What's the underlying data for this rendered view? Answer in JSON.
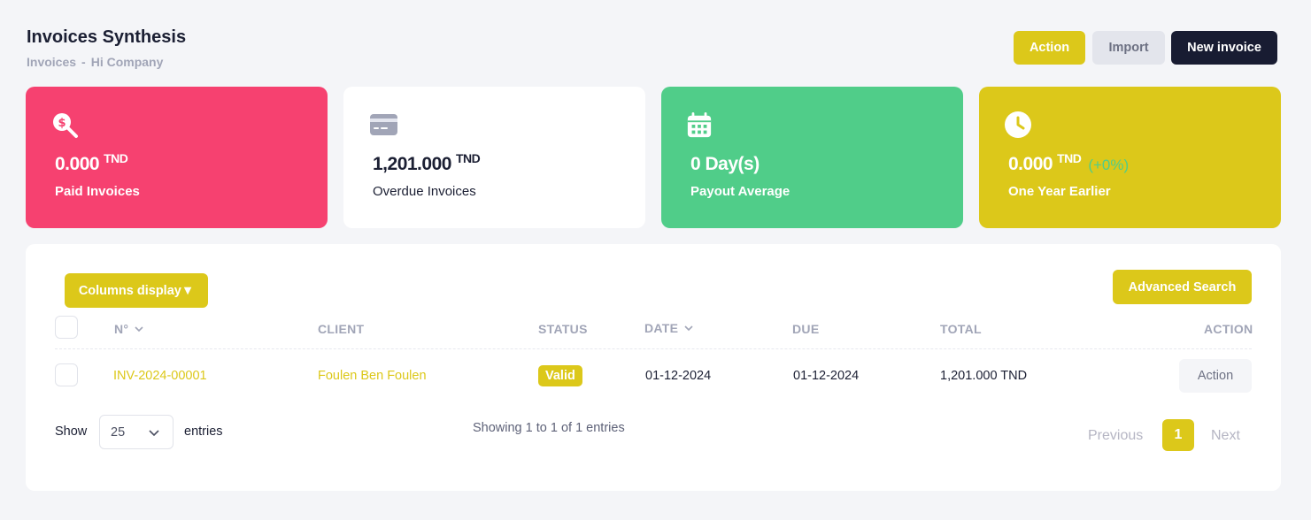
{
  "header": {
    "title": "Invoices Synthesis",
    "breadcrumb": [
      "Invoices",
      "-",
      "Hi Company"
    ]
  },
  "toolbar": {
    "action_label": "Action",
    "import_label": "Import",
    "new_invoice_label": "New invoice"
  },
  "cards": [
    {
      "icon": "search-dollar-icon",
      "value": "0.000",
      "unit": "TND",
      "label": "Paid Invoices",
      "color": "#f64170"
    },
    {
      "icon": "credit-card-icon",
      "value": "1,201.000",
      "unit": "TND",
      "label": "Overdue Invoices",
      "color": "#ffffff"
    },
    {
      "icon": "calendar-icon",
      "value": "0 Day(s)",
      "label": "Payout Average",
      "color": "#50cd89"
    },
    {
      "icon": "clock-icon",
      "value": "0.000",
      "unit": "TND",
      "delta": "(+0%)",
      "label": "One Year Earlier",
      "color": "#dcc81a"
    }
  ],
  "table": {
    "columns_display_label": "Columns display▼",
    "advanced_search_label": "Advanced Search",
    "headers": [
      "N°",
      "CLIENT",
      "STATUS",
      "DATE",
      "DUE",
      "TOTAL",
      "ACTION"
    ],
    "rows": [
      {
        "number": "INV-2024-00001",
        "client": "Foulen Ben Foulen",
        "status": "Valid",
        "date": "01-12-2024",
        "due": "01-12-2024",
        "total": "1,201.000 TND",
        "action": "Action"
      }
    ]
  },
  "footer": {
    "show_label": "Show",
    "page_size": "25",
    "entries_label": "entries",
    "showing_text": "Showing 1 to 1 of 1 entries",
    "previous_label": "Previous",
    "current_page": "1",
    "next_label": "Next"
  },
  "colors": {
    "accent": "#dcc81a",
    "dark": "#181c32",
    "danger": "#f64170",
    "success": "#50cd89"
  }
}
